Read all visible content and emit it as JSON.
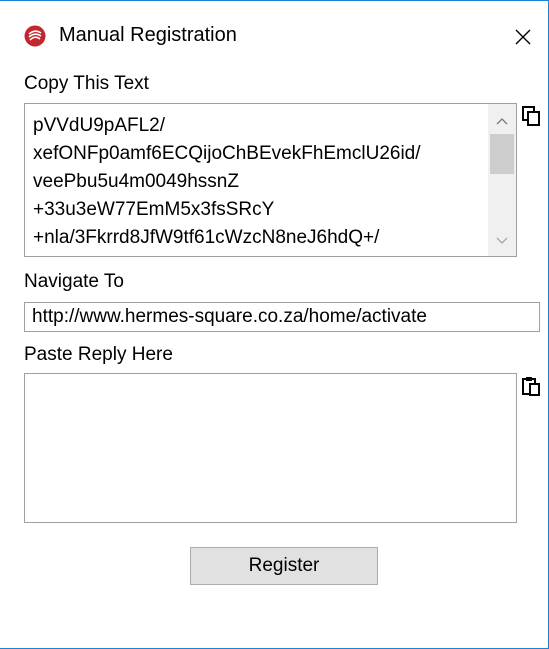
{
  "window": {
    "title": "Manual Registration",
    "app_icon": "red-feather-logo-icon",
    "close_icon": "close-icon"
  },
  "copy_section": {
    "label": "Copy This Text",
    "lines": [
      "pVVdU9pAFL2/",
      "xefONFp0amf6ECQijoChBEvekFhEmclU26id/",
      "veePbu5u4m0049hssnZ",
      "+33u3eW77EmM5x3fsSRcY",
      "+nla/3Fkrrd8JfW9tf61cWzcN8neJ6hdQ+/"
    ],
    "copy_icon": "copy-icon"
  },
  "navigate_section": {
    "label": "Navigate To",
    "url": "http://www.hermes-square.co.za/home/activate"
  },
  "paste_section": {
    "label": "Paste Reply Here",
    "value": "",
    "paste_icon": "paste-icon"
  },
  "register_button": {
    "label": "Register"
  },
  "colors": {
    "window_border": "#1883d7",
    "field_border": "#a0a0a0",
    "button_bg": "#e1e1e1",
    "logo_red": "#c0282d"
  }
}
